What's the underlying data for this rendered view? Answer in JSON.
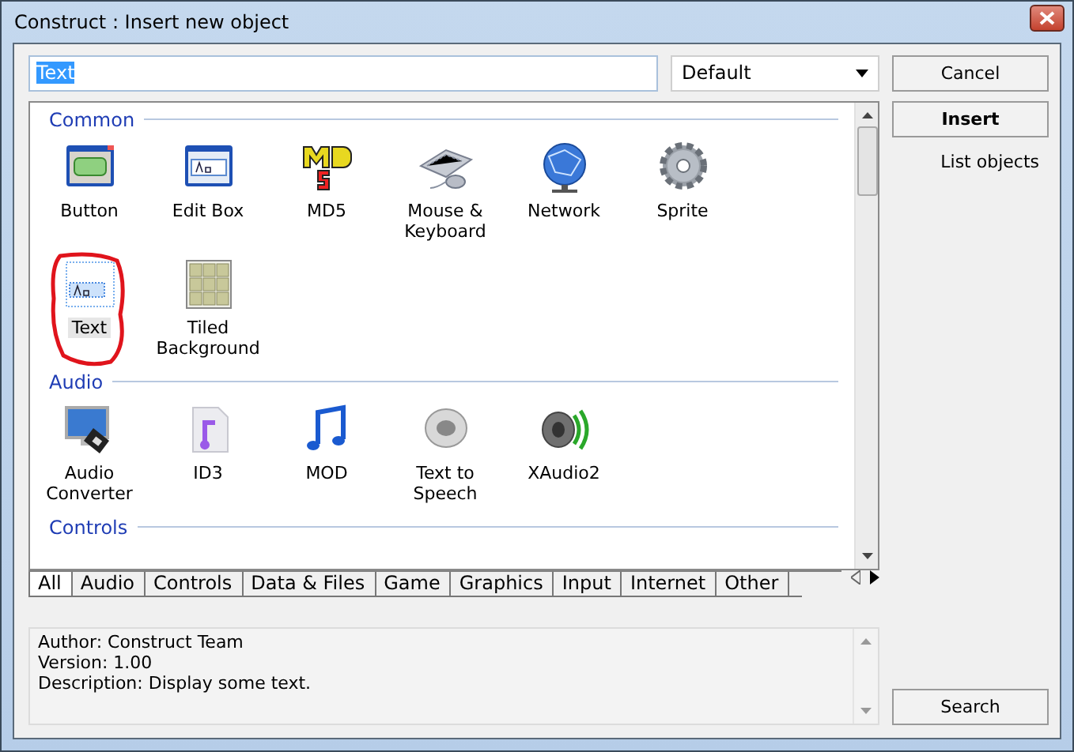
{
  "window": {
    "title": "Construct : Insert new object"
  },
  "search": {
    "value": "Text"
  },
  "filter": {
    "value": "Default"
  },
  "groups": [
    {
      "title": "Common",
      "items": [
        {
          "label": "Button",
          "kind": "button",
          "selected": false
        },
        {
          "label": "Edit Box",
          "kind": "editbox",
          "selected": false
        },
        {
          "label": "MD5",
          "kind": "md5",
          "selected": false
        },
        {
          "label": "Mouse & Keyboard",
          "kind": "mouse",
          "selected": false
        },
        {
          "label": "Network",
          "kind": "globe",
          "selected": false
        },
        {
          "label": "Sprite",
          "kind": "gear",
          "selected": false
        },
        {
          "label": "Text",
          "kind": "text",
          "selected": true
        },
        {
          "label": "Tiled Background",
          "kind": "tiles",
          "selected": false
        }
      ]
    },
    {
      "title": "Audio",
      "items": [
        {
          "label": "Audio Converter",
          "kind": "converter",
          "selected": false
        },
        {
          "label": "ID3",
          "kind": "id3",
          "selected": false
        },
        {
          "label": "MOD",
          "kind": "note",
          "selected": false
        },
        {
          "label": "Text to Speech",
          "kind": "speaker",
          "selected": false
        },
        {
          "label": "XAudio2",
          "kind": "speakerwaves",
          "selected": false
        }
      ]
    },
    {
      "title": "Controls"
    }
  ],
  "tabs": [
    {
      "label": "All",
      "selected": true
    },
    {
      "label": "Audio",
      "selected": false
    },
    {
      "label": "Controls",
      "selected": false
    },
    {
      "label": "Data & Files",
      "selected": false
    },
    {
      "label": "Game",
      "selected": false
    },
    {
      "label": "Graphics",
      "selected": false
    },
    {
      "label": "Input",
      "selected": false
    },
    {
      "label": "Internet",
      "selected": false
    },
    {
      "label": "Other",
      "selected": false
    }
  ],
  "description": [
    "Author: Construct Team",
    "Version: 1.00",
    "Description: Display some text."
  ],
  "buttons": {
    "cancel": "Cancel",
    "insert": "Insert",
    "list": "List objects",
    "search": "Search"
  }
}
